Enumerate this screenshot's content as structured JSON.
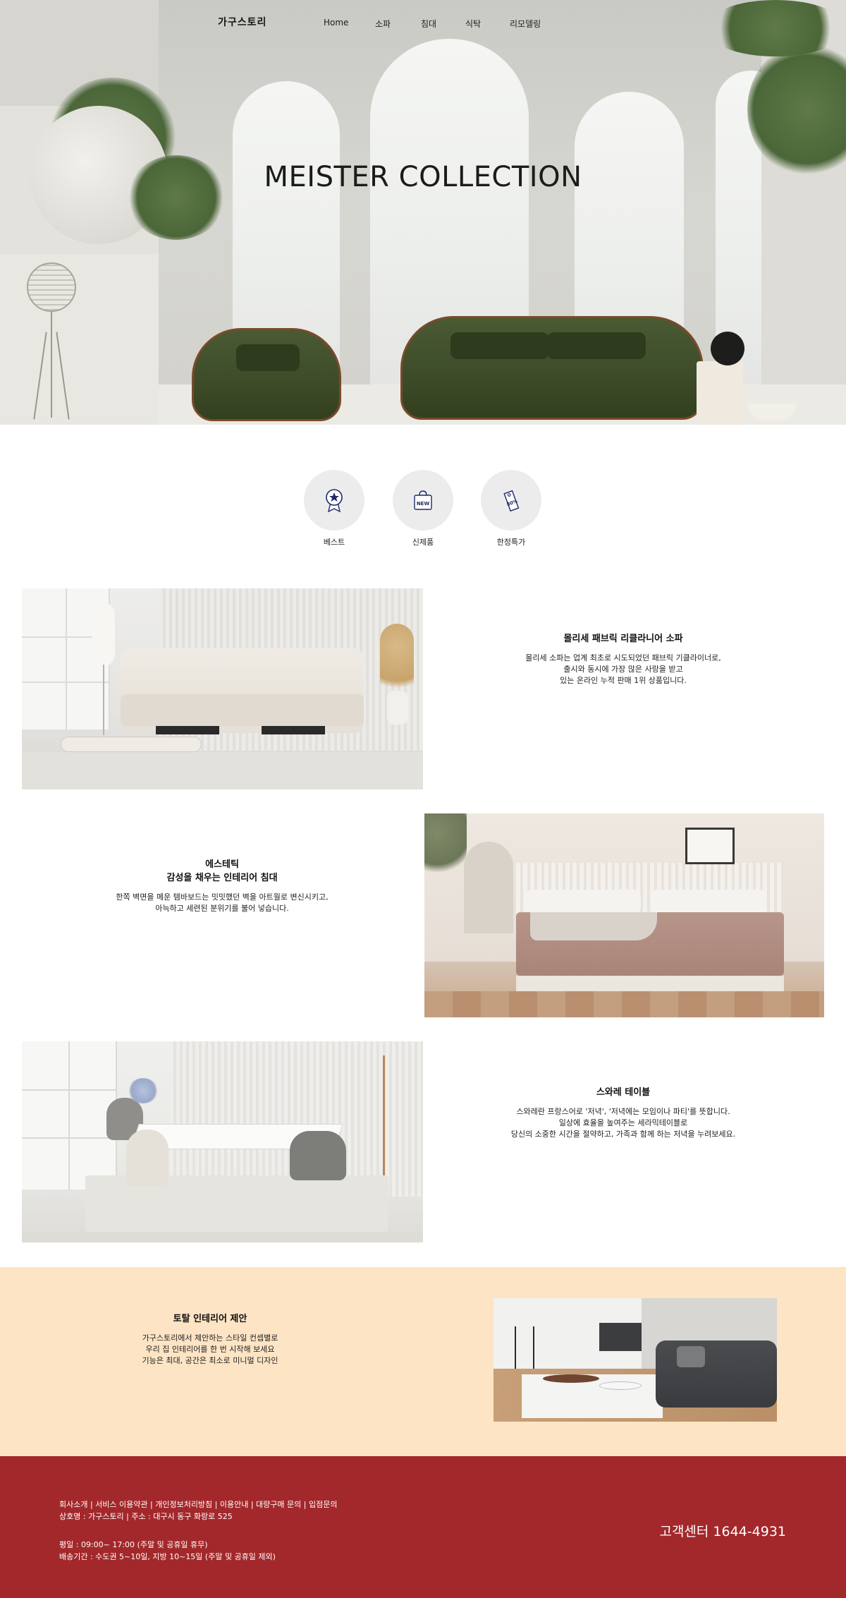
{
  "header": {
    "logo": "가구스토리",
    "nav": [
      "Home",
      "소파",
      "침대",
      "식탁",
      "리모델링"
    ]
  },
  "hero": {
    "title": "MEISTER COLLECTION"
  },
  "categories": [
    {
      "label": "베스트",
      "icon": "best-medal-icon"
    },
    {
      "label": "신제품",
      "icon": "new-bag-icon",
      "icon_text": "NEW"
    },
    {
      "label": "한정특가",
      "icon": "sale-tag-icon",
      "icon_text": "80%"
    }
  ],
  "features": [
    {
      "title": "몰리세 패브릭 리클라니어 소파",
      "desc": [
        "몰리세 소파는 업계 최초로 시도되었던 패브릭 기클라이너로,",
        "출시와 동시에 가장 많은 사랑을 받고",
        "있는 온라인 누적 판매 1위 상품입니다."
      ]
    },
    {
      "title": "에스테틱",
      "title2": "감성을 채우는 인테리어 침대",
      "desc": [
        "한쪽 벽면을 메운 템바보드는 밋밋했던 벽을 아트월로 변신시키고,",
        "아늑하고 세련된 분위기를 불어 넣습니다."
      ]
    },
    {
      "title": "스와레 테이블",
      "desc": [
        "스와레란 프랑스어로 '저녁', '저녁에는 모임이나 파티'를 뜻합니다.",
        "일상에 효율을 높여주는 세라믹테이블로",
        "당신의 소중한 시간을 절약하고, 가족과 함께 하는 저녁을 누려보세요."
      ]
    }
  ],
  "promo": {
    "title": "토탈 인테리어 제안",
    "desc": [
      "가구스토리에서 제안하는 스타일 컨셉별로",
      "우리 집 인테리어를 한 번 시작해 보세요",
      "기능은 최대, 공간은 최소로 미니멀 디자인"
    ]
  },
  "footer": {
    "links": "회사소개 | 서비스 이용약관 | 개인정보처리방침 | 이용안내 | 대량구매 문의 | 입점문의",
    "company": "상호명 : 가구스토리 | 주소 : 대구시 동구 화랑로 525",
    "hours": "평일 : 09:00~ 17:00 (주말 및 공휴일 휴무)",
    "shipping": "배송기간 : 수도권 5~10일, 지방 10~15일 (주말 및 공휴일 제외)",
    "customer_center": "고객센터 1644-4931"
  },
  "colors": {
    "promo_bg": "#fde4c4",
    "footer_bg": "#a3282b",
    "category_circle": "#ececec",
    "accent_navy": "#1f2a6b"
  }
}
